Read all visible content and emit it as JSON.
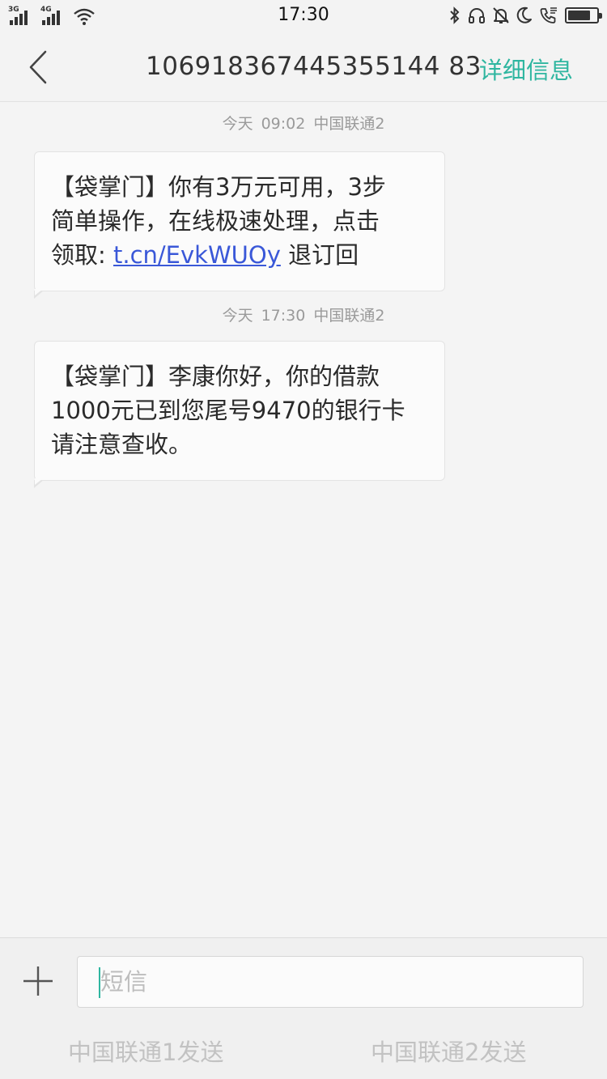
{
  "status_bar": {
    "signal1_label": "3G",
    "signal2_label": "4G",
    "time": "17:30"
  },
  "header": {
    "sender": "106918367445355144 83",
    "detail_label": "详细信息"
  },
  "messages": [
    {
      "date": "今天",
      "time": "09:02",
      "carrier": "中国联通2",
      "lines": [
        "【袋掌门】你有3万元可用，3步",
        "简单操作，在线极速处理，点击"
      ],
      "last_prefix": "领取: ",
      "link": "t.cn/EvkWUOy",
      "last_suffix": " 退订回"
    },
    {
      "date": "今天",
      "time": "17:30",
      "carrier": "中国联通2",
      "lines": [
        "【袋掌门】李康你好，你的借款",
        "1000元已到您尾号9470的银行卡",
        "请注意查收。"
      ]
    }
  ],
  "composer": {
    "placeholder": "短信",
    "send_sim1": "中国联通1发送",
    "send_sim2": "中国联通2发送"
  },
  "icons": {
    "back": "chevron-left-icon",
    "add": "plus-icon",
    "status": [
      "bluetooth-icon",
      "headset-icon",
      "bell-off-icon",
      "moon-icon",
      "phone-icon",
      "battery-icon"
    ]
  },
  "colors": {
    "accent": "#2fb6a0",
    "link": "#3a58d8"
  }
}
